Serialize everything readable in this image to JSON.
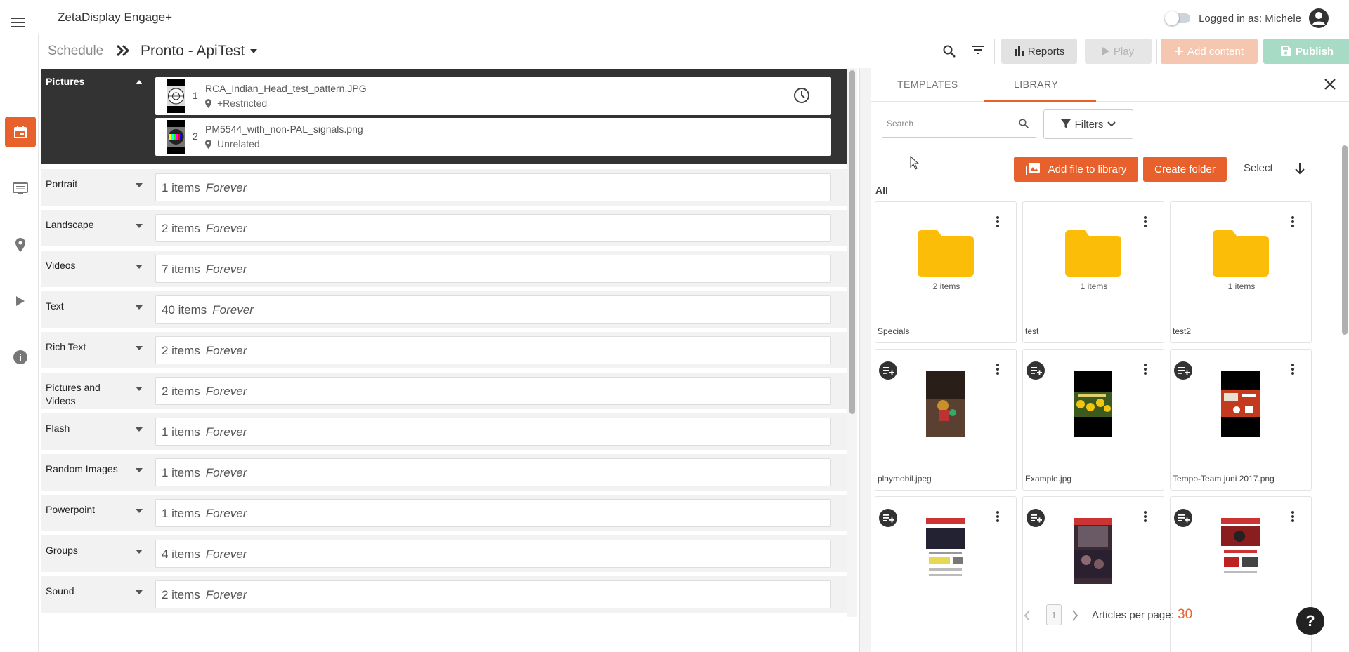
{
  "app": {
    "title": "ZetaDisplay Engage+",
    "logged_in": "Logged in as: Michele"
  },
  "breadcrumb": {
    "root": "Schedule",
    "current": "Pronto - ApiTest"
  },
  "toolbar": {
    "reports": "Reports",
    "play": "Play",
    "add_content": "Add content",
    "publish": "Publish"
  },
  "open_group": {
    "label": "Pictures",
    "items": [
      {
        "index": "1",
        "name": "RCA_Indian_Head_test_pattern.JPG",
        "tag": "+Restricted"
      },
      {
        "index": "2",
        "name": "PM5544_with_non-PAL_signals.png",
        "tag": "Unrelated"
      }
    ]
  },
  "groups": [
    {
      "label": "Portrait",
      "count": "1 items",
      "duration": "Forever"
    },
    {
      "label": "Landscape",
      "count": "2 items",
      "duration": "Forever"
    },
    {
      "label": "Videos",
      "count": "7 items",
      "duration": "Forever"
    },
    {
      "label": "Text",
      "count": "40 items",
      "duration": "Forever"
    },
    {
      "label": "Rich Text",
      "count": "2 items",
      "duration": "Forever"
    },
    {
      "label": "Pictures and Videos",
      "count": "2 items",
      "duration": "Forever"
    },
    {
      "label": "Flash",
      "count": "1 items",
      "duration": "Forever"
    },
    {
      "label": "Random Images",
      "count": "1 items",
      "duration": "Forever"
    },
    {
      "label": "Powerpoint",
      "count": "1 items",
      "duration": "Forever"
    },
    {
      "label": "Groups",
      "count": "4 items",
      "duration": "Forever"
    },
    {
      "label": "Sound",
      "count": "2 items",
      "duration": "Forever"
    }
  ],
  "library": {
    "tabs": [
      "TEMPLATES",
      "LIBRARY"
    ],
    "active_tab": "LIBRARY",
    "search_placeholder": "Search",
    "filters": "Filters",
    "add_file": "Add file to library",
    "create_folder": "Create folder",
    "select": "Select",
    "section": "All",
    "folders": [
      {
        "name": "Specials",
        "count": "2 items"
      },
      {
        "name": "test",
        "count": "1 items"
      },
      {
        "name": "test2",
        "count": "1 items"
      }
    ],
    "media": [
      {
        "name": "playmobil.jpeg"
      },
      {
        "name": "Example.jpg"
      },
      {
        "name": "Tempo-Team juni 2017.png"
      },
      {
        "name": ""
      },
      {
        "name": ""
      },
      {
        "name": ""
      }
    ],
    "pager": {
      "page": "1",
      "per_page_label": "Articles per page:",
      "per_page": "30"
    }
  },
  "help": "?",
  "colors": {
    "accent": "#e8612c",
    "folder": "#fbbd08",
    "dark_group": "#333333"
  }
}
